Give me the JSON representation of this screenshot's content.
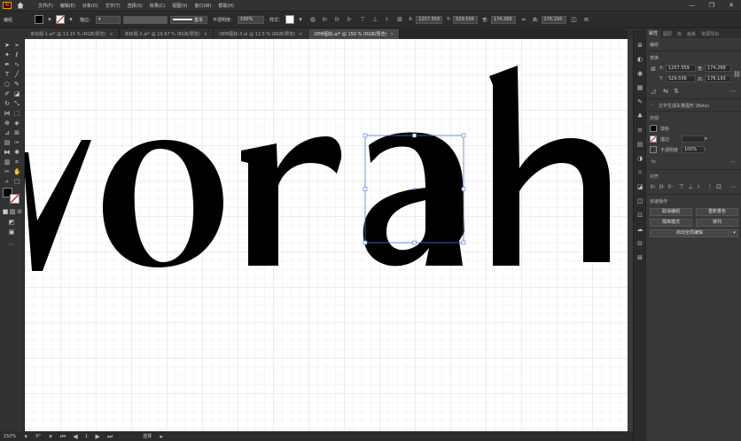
{
  "app": {
    "logo": "Ai"
  },
  "menu": [
    "文件(F)",
    "编辑(E)",
    "对象(O)",
    "文字(T)",
    "选择(S)",
    "效果(C)",
    "视图(V)",
    "窗口(W)",
    "帮助(H)"
  ],
  "options": {
    "selection_label": "编组",
    "stroke_label": "描边：",
    "stroke_style": "基本",
    "opacity_label": "不透明度：",
    "opacity_value": "100%",
    "style_label": "样式：",
    "x_value": "1257.559",
    "y_value": "529.556",
    "w_value": "174.268",
    "h_value": "176.193"
  },
  "tabs": [
    {
      "label": "未标题-1.ai* @ 13.15 % (RGB/预览)",
      "active": false
    },
    {
      "label": "未标题-2.ai* @ 19.67 % (RGB/预览)",
      "active": false
    },
    {
      "label": "OEM图标-3.ai @ 12.5 % (RGB/预览)",
      "active": false
    },
    {
      "label": "OEM图标.ai* @ 150 % (RGB/预览)",
      "active": true
    }
  ],
  "canvas": {
    "letters": "vorah",
    "fill_color": "#000000",
    "selection_color": "#4a78d8"
  },
  "status": {
    "zoom": "150%",
    "angle": "0°",
    "page": "1",
    "mode": "选择"
  },
  "panel": {
    "tabs": [
      "属性",
      "图层",
      "库",
      "画板",
      "资源导出"
    ],
    "active_tab": "属性",
    "group_title": "编组",
    "transform_title": "变换",
    "x": "1257.559",
    "y": "529.556",
    "w": "174.268",
    "h": "176.193",
    "text_note": "文字生成矢量图形 (Beta)",
    "appearance_title": "外观",
    "fill_label": "填色",
    "stroke_label": "描边",
    "opacity_label": "不透明度",
    "opacity_value": "100%",
    "fx_label": "fx.",
    "align_title": "对齐",
    "quick_actions_title": "快速操作",
    "btn_ungroup": "取消编组",
    "btn_recolor": "重新着色",
    "btn_isolate": "隔离模式",
    "btn_arrange": "排列",
    "btn_global_edit": "启动全局编辑"
  }
}
